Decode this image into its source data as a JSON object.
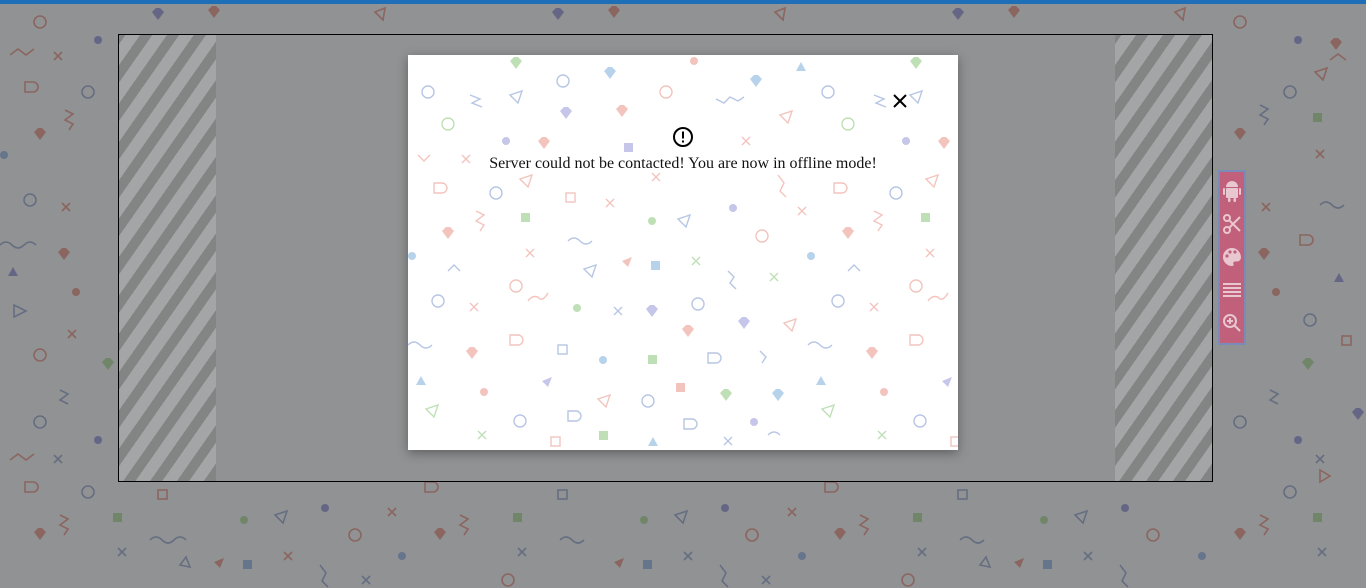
{
  "dialog": {
    "message": "Server could not be contacted! You are now in offline mode!"
  },
  "icons": {
    "close": "close-icon",
    "alert": "alert-circle-icon"
  },
  "toolbar": {
    "tools": [
      "android-icon",
      "scissors-icon",
      "palette-icon",
      "menu-lines-icon",
      "zoom-in-icon"
    ]
  },
  "colors": {
    "top_strip": "#1e6fb7",
    "toolbar_bg": "#c0607a",
    "toolbar_border": "#7a8bb8",
    "overlay": "rgba(0,0,0,0.40)"
  }
}
